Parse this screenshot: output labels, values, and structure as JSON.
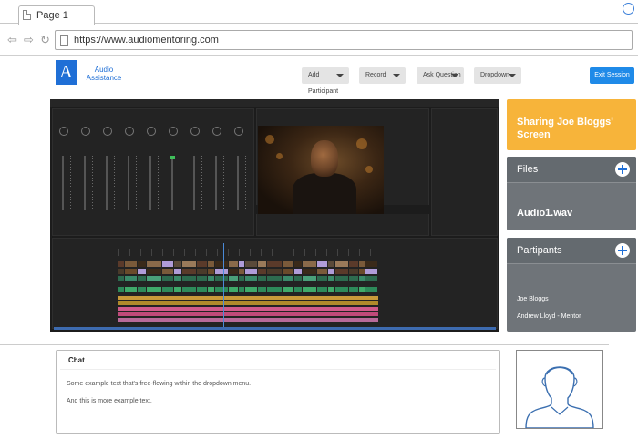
{
  "browser": {
    "tab_title": "Page 1",
    "url": "https://www.audiomentoring.com",
    "nav_icons": [
      "back-arrow-icon",
      "forward-arrow-icon",
      "refresh-icon",
      "page-icon",
      "user-circle-icon"
    ]
  },
  "app": {
    "logo_letter": "A",
    "brand_name": "Audio Assistance",
    "dropdowns": [
      {
        "label": "Add Participant"
      },
      {
        "label": "Record"
      },
      {
        "label": "Ask Question"
      },
      {
        "label": "Dropdown"
      }
    ],
    "exit_label": "Exit Session",
    "accent_color": "#1f6fd6"
  },
  "share": {
    "banner": "Sharing Joe Bloggs' Screen",
    "banner_color": "#f7b43a"
  },
  "files": {
    "title": "Files",
    "items": [
      "Audio1.wav"
    ]
  },
  "participants": {
    "title": "Partipants",
    "items": [
      "Joe Bloggs",
      "Andrew Lloyd - Mentor"
    ]
  },
  "chat": {
    "title": "Chat",
    "messages": [
      "Some example text that's free-flowing within the dropdown menu.",
      "And this is more example text."
    ]
  }
}
